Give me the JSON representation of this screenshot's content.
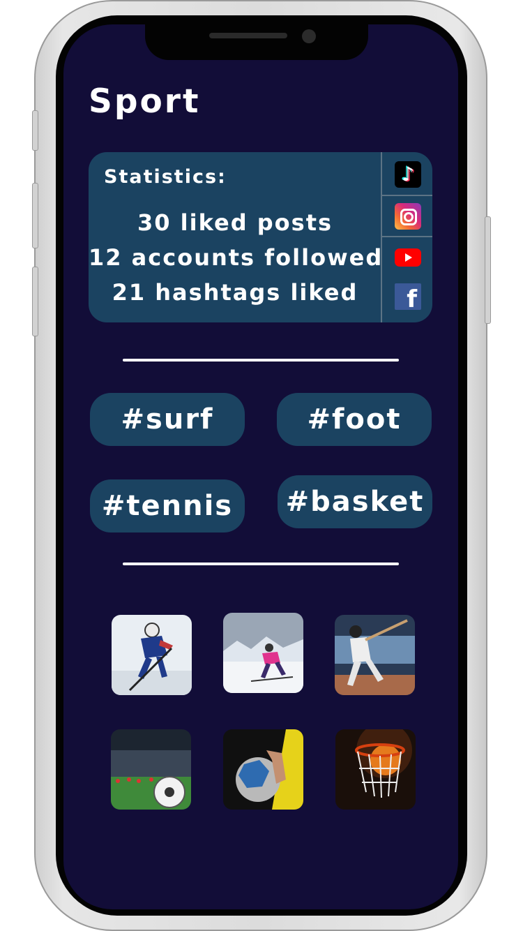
{
  "page": {
    "title": "Sport"
  },
  "stats": {
    "label": "Statistics:",
    "lines": [
      "30 liked posts",
      "12 accounts followed",
      "21 hashtags liked"
    ]
  },
  "social": [
    {
      "name": "tiktok",
      "icon": "tiktok-icon",
      "glyph": "♪"
    },
    {
      "name": "instagram",
      "icon": "instagram-icon"
    },
    {
      "name": "youtube",
      "icon": "youtube-icon"
    },
    {
      "name": "facebook",
      "icon": "facebook-icon",
      "glyph": "f"
    }
  ],
  "hashtags": [
    "#surf",
    "#foot",
    "#tennis",
    "#basket"
  ],
  "gallery": [
    {
      "subject": "ice-hockey"
    },
    {
      "subject": "skiing"
    },
    {
      "subject": "baseball"
    },
    {
      "subject": "football-stadium"
    },
    {
      "subject": "handball"
    },
    {
      "subject": "basketball-hoop"
    }
  ],
  "colors": {
    "screen_bg": "#120d38",
    "card_bg": "#1b4361",
    "text": "#ffffff"
  }
}
